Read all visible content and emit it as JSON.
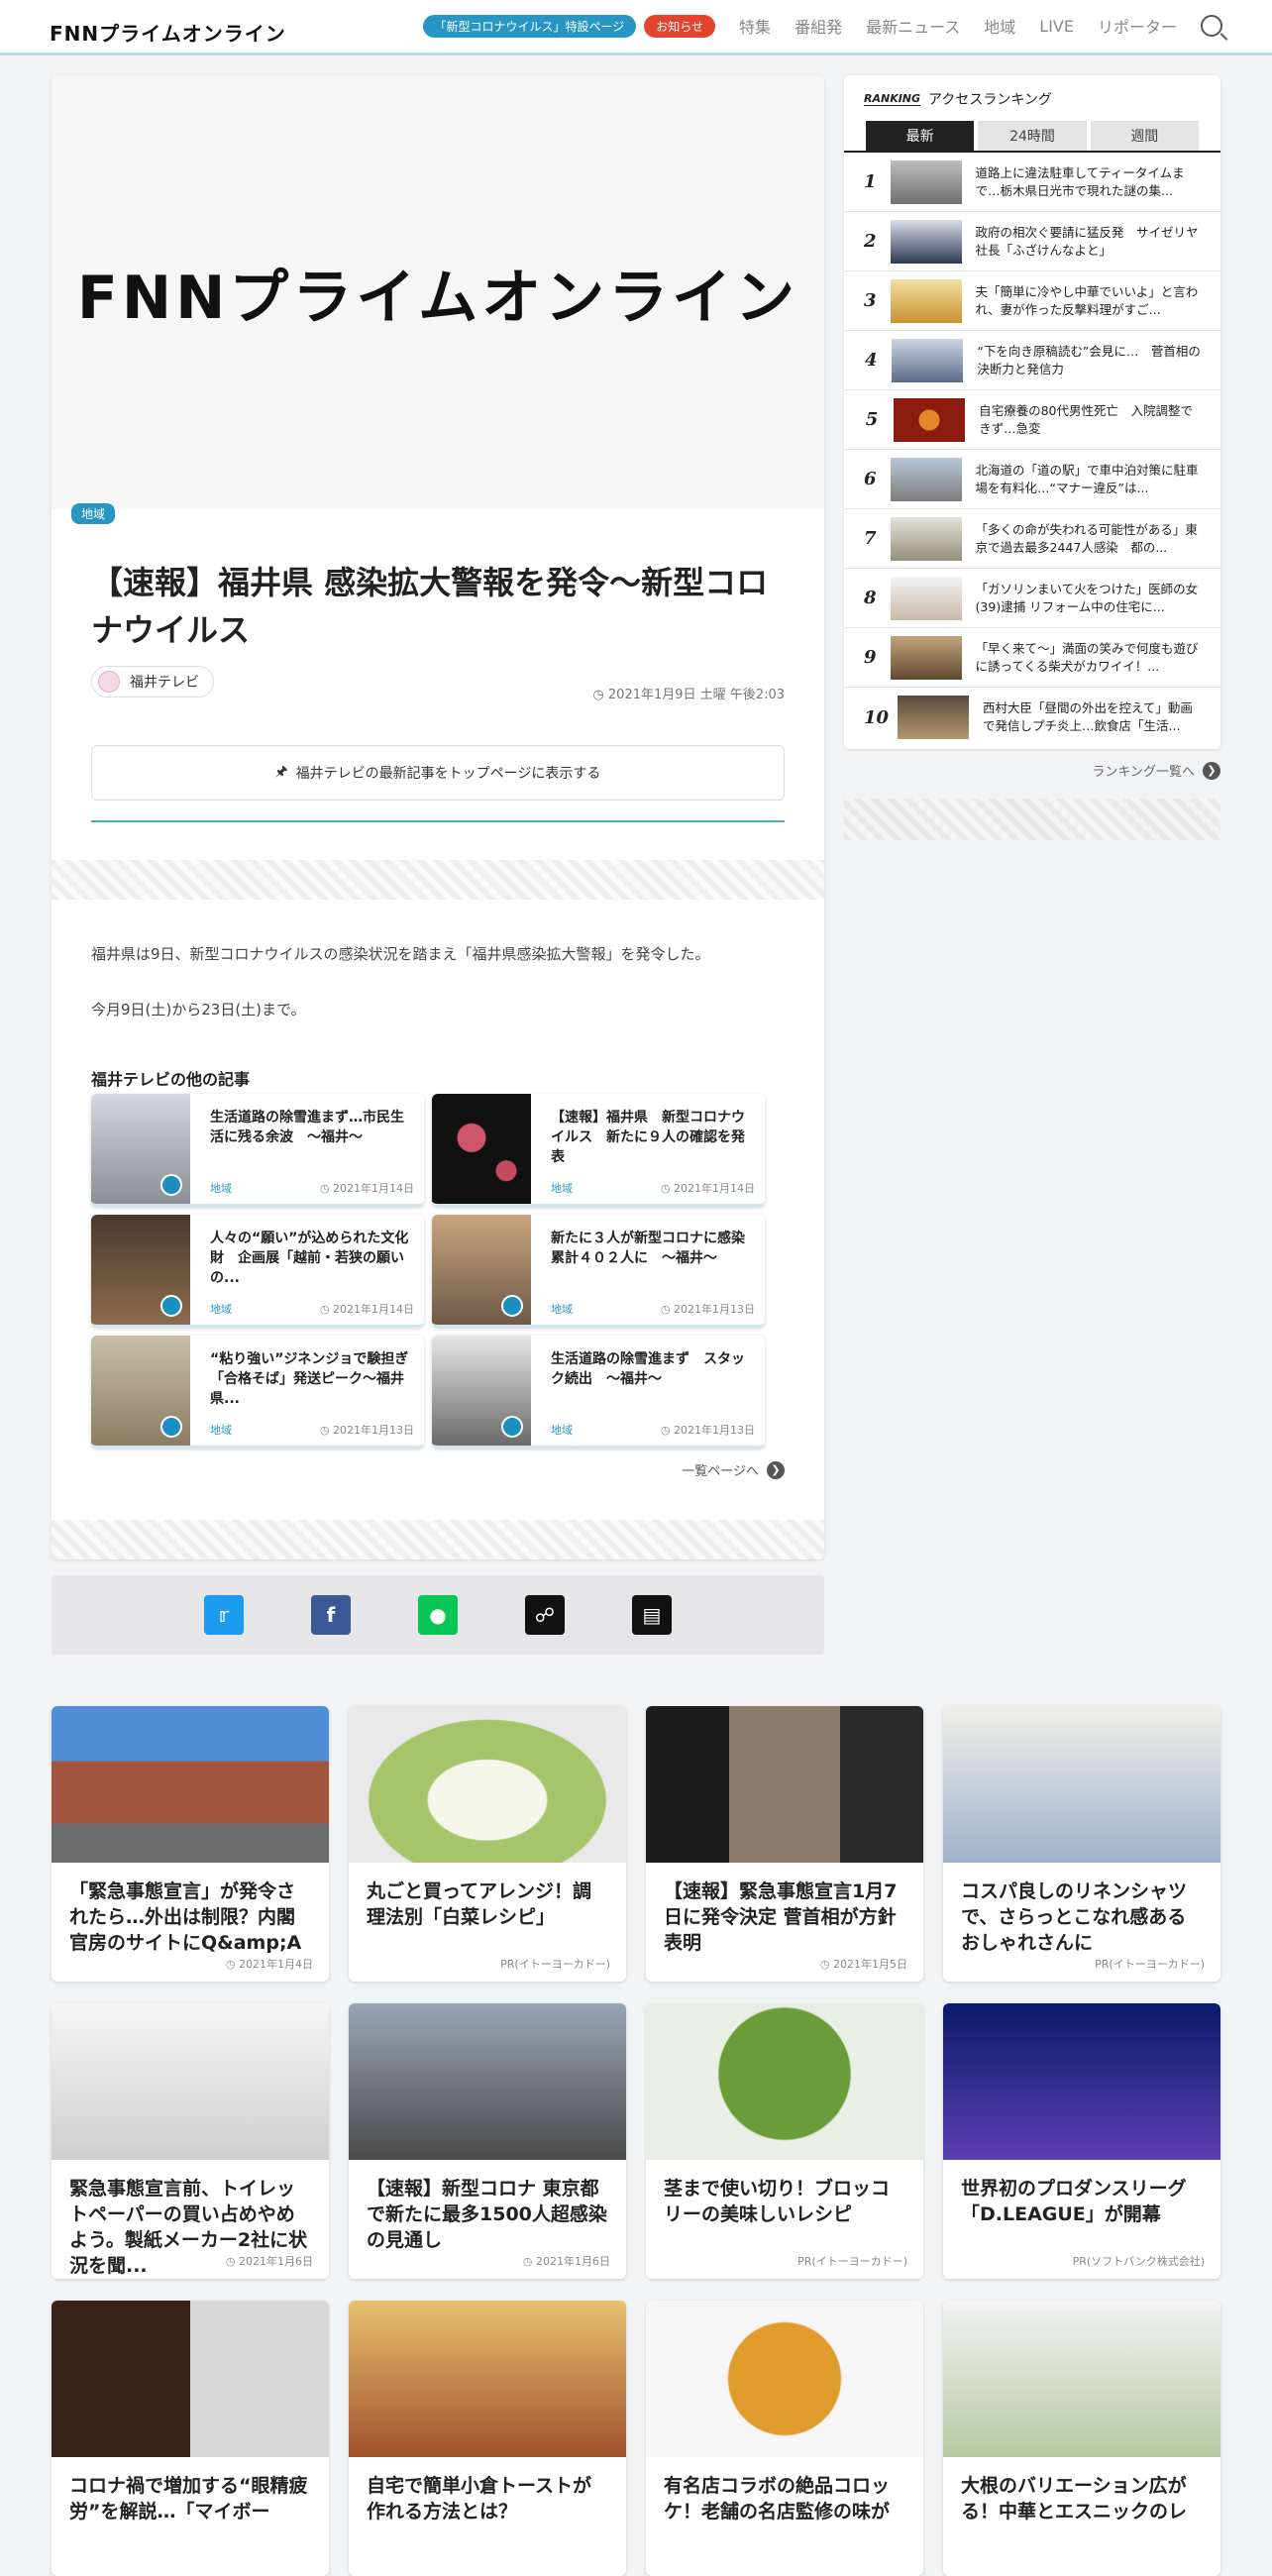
{
  "header": {
    "logo": "FNNプライムオンライン",
    "corona_pill": "「新型コロナウイルス」特設ページ",
    "notice_pill": "お知らせ",
    "nav": [
      "特集",
      "番組発",
      "最新ニュース",
      "地域",
      "LIVE",
      "リポーター"
    ]
  },
  "article": {
    "hero_logo": "FNNプライムオンライン",
    "category": "地域",
    "title": "【速報】福井県 感染拡大警報を発令～新型コロナウイルス",
    "source": "福井テレビ",
    "date": "2021年1月9日 土曜 午後2:03",
    "pin_label": "福井テレビの最新記事をトップページに表示する",
    "body": [
      "福井県は9日、新型コロナウイルスの感染状況を踏まえ「福井県感染拡大警報」を発令した。",
      "今月9日(土)から23日(土)まで。"
    ],
    "related_heading": "福井テレビの他の記事",
    "related": [
      {
        "title": "生活道路の除雪進まず…市民生活に残る余波　～福井～",
        "cat": "地域",
        "date": "2021年1月14日"
      },
      {
        "title": "【速報】福井県　新型コロナウイルス　新たに９人の確認を発表",
        "cat": "地域",
        "date": "2021年1月14日"
      },
      {
        "title": "人々の“願い”が込められた文化財　企画展「越前・若狭の願いの...",
        "cat": "地域",
        "date": "2021年1月14日"
      },
      {
        "title": "新たに３人が新型コロナに感染　累計４０２人に　～福井～",
        "cat": "地域",
        "date": "2021年1月13日"
      },
      {
        "title": "“粘り強い”ジネンジョで験担ぎ「合格そば」発送ピーク～福井県...",
        "cat": "地域",
        "date": "2021年1月13日"
      },
      {
        "title": "生活道路の除雪進まず　スタック続出　～福井～",
        "cat": "地域",
        "date": "2021年1月13日"
      }
    ],
    "more_label": "一覧ページへ"
  },
  "ranking": {
    "label_en": "RANKING",
    "label": "アクセスランキング",
    "tabs": [
      "最新",
      "24時間",
      "週間"
    ],
    "items": [
      {
        "rank": "1",
        "text": "道路上に違法駐車してティータイムまで…栃木県日光市で現れた謎の集..."
      },
      {
        "rank": "2",
        "text": "政府の相次ぐ要請に猛反発　サイゼリヤ社長「ふざけんなよと」"
      },
      {
        "rank": "3",
        "text": "夫「簡単に冷やし中華でいいよ」と言われ、妻が作った反撃料理がすご..."
      },
      {
        "rank": "4",
        "text": "“下を向き原稿読む”会見に…　菅首相の決断力と発信力"
      },
      {
        "rank": "5",
        "text": "自宅療養の80代男性死亡　入院調整できず…急変"
      },
      {
        "rank": "6",
        "text": "北海道の「道の駅」で車中泊対策に駐車場を有料化…“マナー違反”は..."
      },
      {
        "rank": "7",
        "text": "「多くの命が失われる可能性がある」東京で過去最多2447人感染　都の..."
      },
      {
        "rank": "8",
        "text": "「ガソリンまいて火をつけた」医師の女(39)逮捕 リフォーム中の住宅に..."
      },
      {
        "rank": "9",
        "text": "「早く来て～」満面の笑みで何度も遊びに誘ってくる柴犬がカワイイ！..."
      },
      {
        "rank": "10",
        "text": "西村大臣「昼間の外出を控えて」動画で発信しプチ炎上…飲食店「生活..."
      }
    ],
    "more_label": "ランキング一覧へ"
  },
  "grid": [
    {
      "title": "「緊急事態宣言」が発令されたら…外出は制限？内閣官房のサイトにQ&amp;A",
      "meta": "2021年1月4日",
      "clock": true
    },
    {
      "title": "丸ごと買ってアレンジ！調理法別「白菜レシピ」",
      "meta": "PR(イトーヨーカドー)",
      "clock": false
    },
    {
      "title": "【速報】緊急事態宣言1月7日に発令決定 菅首相が方針表明",
      "meta": "2021年1月5日",
      "clock": true
    },
    {
      "title": "コスパ良しのリネンシャツで、さらっとこなれ感あるおしゃれさんに",
      "meta": "PR(イトーヨーカドー)",
      "clock": false
    },
    {
      "title": "緊急事態宣言前、トイレットペーパーの買い占めやめよう。製紙メーカー2社に状況を聞...",
      "meta": "2021年1月6日",
      "clock": true
    },
    {
      "title": "【速報】新型コロナ 東京都で新たに最多1500人超感染の見通し",
      "meta": "2021年1月6日",
      "clock": true
    },
    {
      "title": "茎まで使い切り！ブロッコリーの美味しいレシピ",
      "meta": "PR(イトーヨーカドー)",
      "clock": false
    },
    {
      "title": "世界初のプロダンスリーグ「D.LEAGUE」が開幕",
      "meta": "PR(ソフトバンク株式会社)",
      "clock": false
    },
    {
      "title": "コロナ禍で増加する“眼精疲労”を解説…「マイボー",
      "meta": "",
      "clock": false
    },
    {
      "title": "自宅で簡単小倉トーストが作れる方法とは？",
      "meta": "",
      "clock": false
    },
    {
      "title": "有名店コラボの絶品コロッケ！老舗の名店監修の味が",
      "meta": "",
      "clock": false
    },
    {
      "title": "大根のバリエーション広がる！中華とエスニックのレ",
      "meta": "",
      "clock": false
    }
  ]
}
